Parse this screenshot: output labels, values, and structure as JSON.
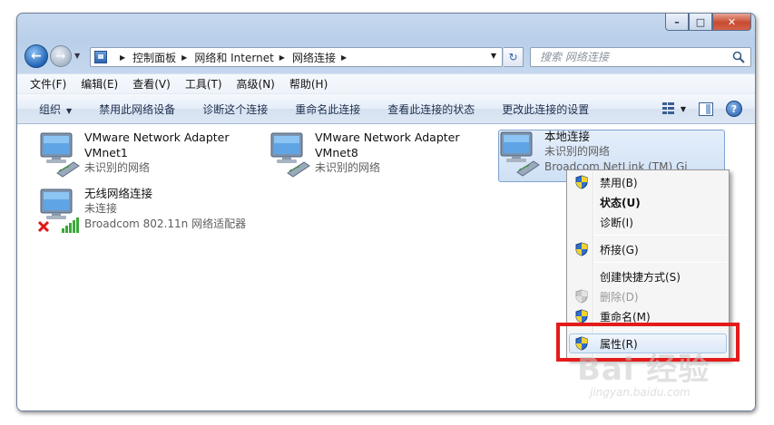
{
  "window": {
    "caption_text": "",
    "buttons": {
      "minimize": "–",
      "maximize": "□",
      "close": "✕"
    }
  },
  "address": {
    "crumbs": [
      "控制面板",
      "网络和 Internet",
      "网络连接"
    ],
    "refresh_glyph": "↻"
  },
  "search": {
    "placeholder": "搜索 网络连接"
  },
  "menubar": [
    "文件(F)",
    "编辑(E)",
    "查看(V)",
    "工具(T)",
    "高级(N)",
    "帮助(H)"
  ],
  "commands": {
    "organize": "组织",
    "disable_device": "禁用此网络设备",
    "diagnose": "诊断这个连接",
    "rename": "重命名此连接",
    "view_status": "查看此连接的状态",
    "change_settings": "更改此连接的设置",
    "help_glyph": "?"
  },
  "connections": [
    {
      "name": "VMware Network Adapter",
      "line2": "VMnet1",
      "line3": "未识别的网络",
      "icon": "network-adapter-icon"
    },
    {
      "name": "VMware Network Adapter",
      "line2": "VMnet8",
      "line3": "未识别的网络",
      "icon": "network-adapter-icon"
    },
    {
      "name": "本地连接",
      "line2": "未识别的网络",
      "line3": "Broadcom NetLink (TM) Gi",
      "icon": "network-adapter-icon",
      "selected": true
    },
    {
      "name": "无线网络连接",
      "line2": "未连接",
      "line3": "Broadcom 802.11n 网络适配器",
      "icon": "wireless-adapter-icon",
      "status_icon": "red-x-icon"
    }
  ],
  "context_menu": {
    "disable": "禁用(B)",
    "status": "状态(U)",
    "diagnose": "诊断(I)",
    "bridge": "桥接(G)",
    "shortcut": "创建快捷方式(S)",
    "delete": "删除(D)",
    "rename": "重命名(M)",
    "properties": "属性(R)"
  },
  "watermark": {
    "text": "Bai 经验",
    "sub": "jingyan.baidu.com"
  },
  "colors": {
    "highlight_box": "#e41b1b",
    "selection": "#cfe0f5"
  }
}
